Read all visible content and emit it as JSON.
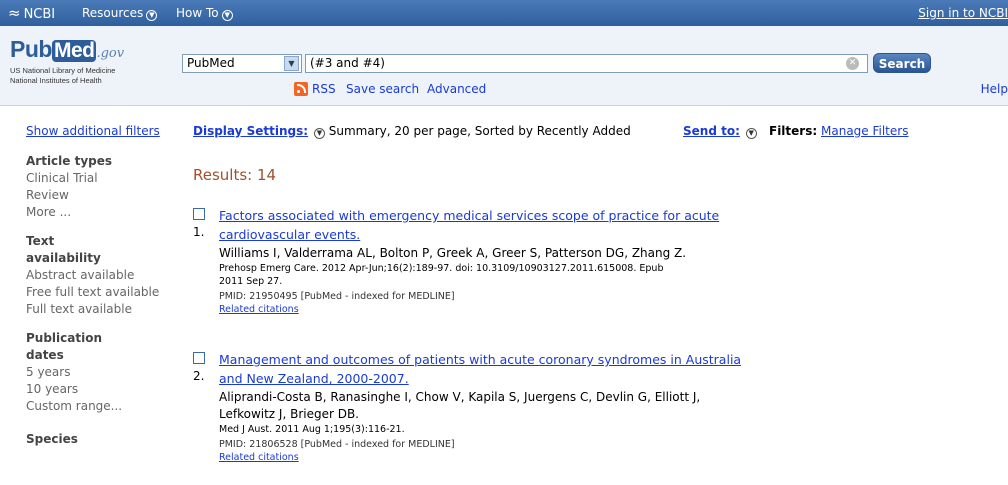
{
  "topbar": {
    "ncbi_label": "NCBI",
    "resources_label": "Resources",
    "howto_label": "How To",
    "signin_label": "Sign in to NCBI"
  },
  "header": {
    "logo_pub": "Pub",
    "logo_med": "Med",
    "logo_gov": ".gov",
    "logo_sub1": "US National Library of Medicine",
    "logo_sub2": "National Institutes of Health",
    "database": "PubMed",
    "query": "(#3 and #4)",
    "search_button": "Search",
    "rss": "RSS",
    "save_search": "Save search",
    "advanced": "Advanced",
    "help": "Help"
  },
  "sidebar": {
    "show_filters": "Show additional filters",
    "groups": [
      {
        "title": "Article types",
        "options": [
          "Clinical Trial",
          "Review",
          "More ..."
        ]
      },
      {
        "title": "Text availability",
        "options": [
          "Abstract available",
          "Free full text available",
          "Full text available"
        ]
      },
      {
        "title": "Publication dates",
        "options": [
          "5 years",
          "10 years",
          "Custom range..."
        ]
      },
      {
        "title": "Species",
        "options": []
      }
    ]
  },
  "display": {
    "settings_label": "Display Settings:",
    "settings_value": "Summary, 20 per page, Sorted by Recently Added",
    "send_to": "Send to:",
    "filters_label": "Filters:",
    "manage_filters": "Manage Filters"
  },
  "results": {
    "count_label": "Results: 14",
    "items": [
      {
        "num": "1.",
        "title_line1": "Factors associated with emergency medical services scope of practice for acute",
        "title_line2": "cardiovascular events.",
        "authors": "Williams I, Valderrama AL, Bolton P, Greek A, Greer S, Patterson DG, Zhang Z.",
        "journal_line1": "Prehosp Emerg Care. 2012 Apr-Jun;16(2):189-97. doi: 10.3109/10903127.2011.615008. Epub",
        "journal_line2": "2011 Sep 27.",
        "pmid": "PMID: 21950495 [PubMed - indexed for MEDLINE]",
        "related": "Related citations"
      },
      {
        "num": "2.",
        "title_line1": "Management and outcomes of patients with acute coronary syndromes in Australia",
        "title_line2": "and New Zealand, 2000-2007.",
        "authors_line1": "Aliprandi-Costa B, Ranasinghe I, Chow V, Kapila S, Juergens C, Devlin G, Elliott J,",
        "authors_line2": "Lefkowitz J, Brieger DB.",
        "journal_line1": "Med J Aust. 2011 Aug 1;195(3):116-21.",
        "pmid": "PMID: 21806528 [PubMed - indexed for MEDLINE]",
        "related": "Related citations"
      }
    ]
  }
}
